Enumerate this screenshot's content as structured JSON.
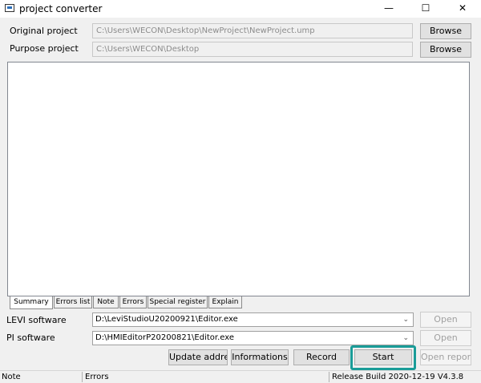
{
  "window": {
    "title": "project converter",
    "minimize_glyph": "—",
    "maximize_glyph": "☐",
    "close_glyph": "✕"
  },
  "paths": {
    "original_label": "Original project",
    "original_value": "C:\\Users\\WECON\\Desktop\\NewProject\\NewProject.ump",
    "purpose_label": "Purpose project",
    "purpose_value": "C:\\Users\\WECON\\Desktop",
    "browse_label": "Browse"
  },
  "tabs": [
    "Summary",
    "Errors list",
    "Note",
    "Errors",
    "Special register",
    "Explain"
  ],
  "software": {
    "levi_label": "LEVI software",
    "levi_value": "D:\\LeviStudioU20200921\\Editor.exe",
    "pi_label": "PI software",
    "pi_value": "D:\\HMIEditorP20200821\\Editor.exe",
    "open_label": "Open"
  },
  "actions": {
    "update_address": "Update address",
    "informations": "Informations",
    "record": "Record",
    "start": "Start",
    "open_report": "Open report"
  },
  "status": {
    "note": "Note",
    "errors": "Errors",
    "build": "Release Build 2020-12-19 V4.3.8"
  },
  "colors": {
    "highlight": "#1a9c98"
  },
  "icons": {
    "app": "window-app-icon",
    "dropdown": "chevron-down-icon"
  }
}
